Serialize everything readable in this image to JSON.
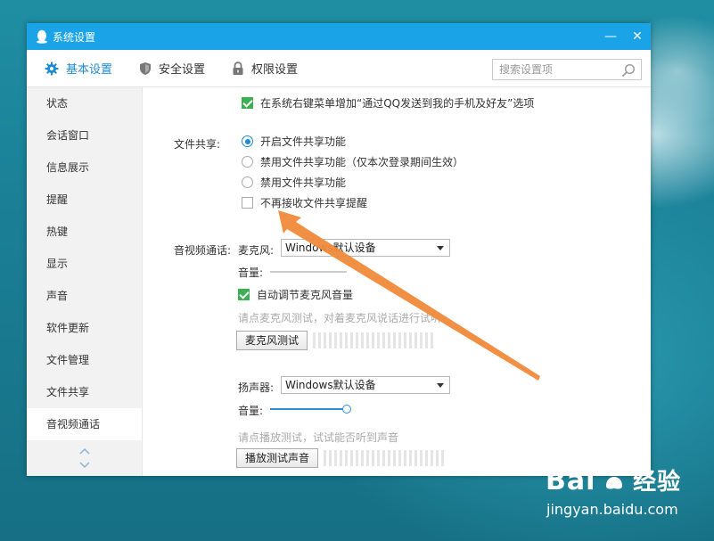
{
  "window": {
    "title": "系统设置",
    "minimize_glyph": "—",
    "close_glyph": "✕"
  },
  "tabs": [
    {
      "label": "基本设置",
      "icon": "gear-icon",
      "active": true
    },
    {
      "label": "安全设置",
      "icon": "shield-icon",
      "active": false
    },
    {
      "label": "权限设置",
      "icon": "lock-icon",
      "active": false
    }
  ],
  "search": {
    "placeholder": "搜索设置项"
  },
  "sidebar": {
    "items": [
      {
        "label": "状态"
      },
      {
        "label": "会话窗口"
      },
      {
        "label": "信息展示"
      },
      {
        "label": "提醒"
      },
      {
        "label": "热键"
      },
      {
        "label": "显示"
      },
      {
        "label": "声音"
      },
      {
        "label": "软件更新"
      },
      {
        "label": "文件管理"
      },
      {
        "label": "文件共享"
      },
      {
        "label": "音视频通话",
        "active": true
      }
    ]
  },
  "content": {
    "context_menu_option": {
      "label": "在系统右键菜单增加“通过QQ发送到我的手机及好友”选项",
      "checked": true
    },
    "file_share": {
      "section_label": "文件共享:",
      "options": [
        {
          "label": "开启文件共享功能",
          "selected": true
        },
        {
          "label": "禁用文件共享功能（仅本次登录期间生效）",
          "selected": false
        },
        {
          "label": "禁用文件共享功能",
          "selected": false
        }
      ],
      "no_reminder": {
        "label": "不再接收文件共享提醒",
        "checked": false
      }
    },
    "av_call": {
      "section_label": "音视频通话:",
      "microphone": {
        "label": "麦克风:",
        "device": "Windows默认设备",
        "volume_label": "音量:",
        "volume_level": 0.0,
        "auto_adjust": {
          "label": "自动调节麦克风音量",
          "checked": true
        },
        "test_hint": "请点麦克风测试，对着麦克风说话进行试听",
        "test_button": "麦克风测试"
      },
      "speaker": {
        "label": "扬声器:",
        "device": "Windows默认设备",
        "volume_label": "音量:",
        "volume_level": 1.0,
        "test_hint": "请点播放测试，试试能否听到声音",
        "test_button": "播放测试声音"
      }
    }
  },
  "watermark": {
    "brand": "Bai",
    "brand_suffix": "经验",
    "url": "jingyan.baidu.com"
  },
  "colors": {
    "titlebar": "#1aa3e6",
    "accent": "#1a8ad4",
    "check": "#3cae54",
    "annotation_arrow": "#f08a3a"
  }
}
